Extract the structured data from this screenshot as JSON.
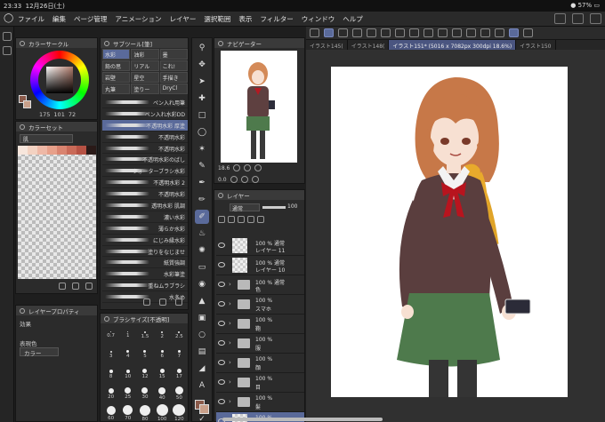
{
  "status": {
    "time": "23:33",
    "date": "12月26日(土)",
    "battery": "57%"
  },
  "menu": [
    "ファイル",
    "編集",
    "ページ管理",
    "アニメーション",
    "レイヤー",
    "選択範囲",
    "表示",
    "フィルター",
    "ウィンドウ",
    "ヘルプ"
  ],
  "colorcircle": {
    "title": "カラーサークル",
    "h": "175",
    "s": "101",
    "v": "72"
  },
  "colorset": {
    "title": "カラーセット",
    "set_name": "肌",
    "swatches": [
      "#f7e6dc",
      "#f3d2c2",
      "#eeb8a6",
      "#e7a08a",
      "#d98470",
      "#c96a58",
      "#b65244",
      "#2a1a18"
    ]
  },
  "layerprop": {
    "title": "レイヤープロパティ",
    "effect_label": "効果",
    "expression_label": "表現色",
    "expression_value": "カラー"
  },
  "subtool": {
    "title": "サブツール[筆]",
    "tabs": [
      "水彩",
      "油彩",
      "墨",
      "鉛の思",
      "リアル",
      "これ!",
      "岩壁",
      "星空",
      "手描き",
      "丸筆",
      "塗りー",
      "DryCl"
    ],
    "brushes": [
      "ペン入れ用筆",
      "ペン入れ水彩DD",
      "不透明水彩 厚塗",
      "不透明水彩",
      "不透明水彩",
      "不透明水彩のばし",
      "ウォーターブラシ水彩",
      "不透明水彩 2",
      "不透明水彩",
      "透明水彩 肌調",
      "濃い水彩",
      "薄らか水彩",
      "にじみ縁水彩",
      "塗りをなじませ",
      "紙質強調",
      "水彩筆塗",
      "重ねムラブラシ",
      "水多め"
    ]
  },
  "brushsize": {
    "title": "ブラシサイズ[不透明]",
    "sizes": [
      "0.7",
      "1",
      "1.5",
      "2",
      "2.5",
      "3",
      "4",
      "5",
      "6",
      "7",
      "8",
      "10",
      "12",
      "15",
      "17",
      "20",
      "25",
      "30",
      "40",
      "50",
      "60",
      "70",
      "80",
      "100",
      "120"
    ]
  },
  "navigator": {
    "title": "ナビゲーター",
    "zoom": "18.6",
    "rotation": "0.0"
  },
  "layers": {
    "title": "レイヤー",
    "blend_mode": "通常",
    "opacity": "100",
    "items": [
      {
        "opacity": "100 %",
        "mode": "通常",
        "name": "レイヤー 11",
        "kind": "layer",
        "active": false
      },
      {
        "opacity": "100 %",
        "mode": "通常",
        "name": "レイヤー 10",
        "kind": "layer",
        "active": false
      },
      {
        "opacity": "100 %",
        "mode": "通常",
        "name": "色",
        "kind": "folder",
        "active": false
      },
      {
        "opacity": "100 %",
        "mode": "",
        "name": "スマホ",
        "kind": "folder",
        "active": false
      },
      {
        "opacity": "100 %",
        "mode": "",
        "name": "鞄",
        "kind": "folder",
        "active": false
      },
      {
        "opacity": "100 %",
        "mode": "",
        "name": "服",
        "kind": "folder",
        "active": false
      },
      {
        "opacity": "100 %",
        "mode": "",
        "name": "顔",
        "kind": "folder",
        "active": false
      },
      {
        "opacity": "100 %",
        "mode": "",
        "name": "目",
        "kind": "folder",
        "active": false
      },
      {
        "opacity": "100 %",
        "mode": "",
        "name": "髪",
        "kind": "folder",
        "active": false
      },
      {
        "opacity": "100 %",
        "mode": "",
        "name": "レイヤー",
        "kind": "layer",
        "active": true
      }
    ]
  },
  "canvas": {
    "tabs": [
      {
        "label": "イラスト145(",
        "active": false
      },
      {
        "label": "イラスト148(",
        "active": false
      },
      {
        "label": "イラスト151* (5016 x 7082px 300dpi 18.6%)",
        "active": true
      },
      {
        "label": "イラスト150",
        "active": false
      }
    ]
  },
  "colors": {
    "accent": "#5a6a9a",
    "panel": "#2b2b2b",
    "background": "#1e1e1e"
  }
}
